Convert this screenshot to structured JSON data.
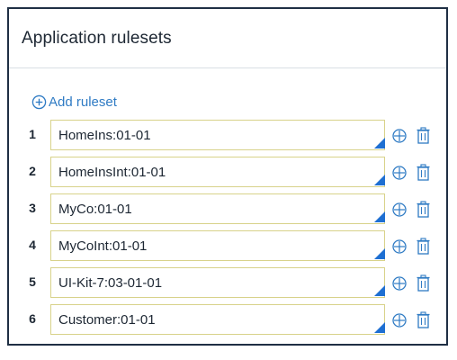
{
  "panel": {
    "title": "Application rulesets",
    "add_label": "Add ruleset"
  },
  "colors": {
    "accent": "#2f7bc4",
    "input_border": "#d8d28a",
    "corner_marker": "#1e6fd2",
    "panel_border": "#1f2f44"
  },
  "icons": {
    "add": "circle-plus-icon",
    "move": "move-crosshair-icon",
    "delete": "trash-icon"
  },
  "rulesets": [
    {
      "index": "1",
      "value": "HomeIns:01-01"
    },
    {
      "index": "2",
      "value": "HomeInsInt:01-01"
    },
    {
      "index": "3",
      "value": "MyCo:01-01"
    },
    {
      "index": "4",
      "value": "MyCoInt:01-01"
    },
    {
      "index": "5",
      "value": "UI-Kit-7:03-01-01"
    },
    {
      "index": "6",
      "value": "Customer:01-01"
    }
  ]
}
